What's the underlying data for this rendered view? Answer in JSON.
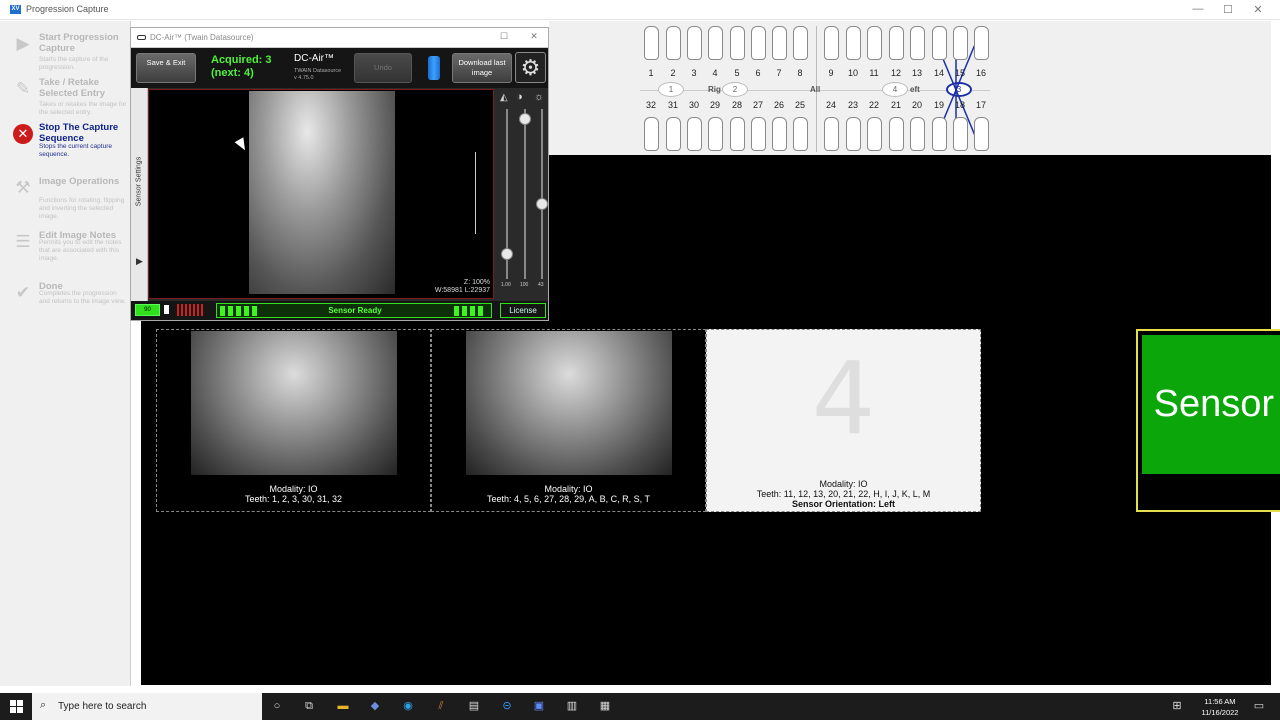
{
  "window": {
    "title": "Progression Capture",
    "app_icon": "XV"
  },
  "steps": [
    {
      "title": "Start Progression Capture",
      "desc": "Starts the capture of the progression.",
      "icon": "play-icon",
      "state": "disabled"
    },
    {
      "title": "Take / Retake Selected Entry",
      "desc": "Takes or retakes the image for the selected entry.",
      "icon": "retake-icon",
      "state": "disabled"
    },
    {
      "title": "Stop The Capture Sequence",
      "desc": "Stops the current capture sequence.",
      "icon": "stop-icon",
      "state": "active"
    },
    {
      "title": "Image Operations",
      "desc": "Functions for rotating, flipping and inverting the selected image.",
      "icon": "wrench-icon",
      "state": "disabled"
    },
    {
      "title": "Edit Image Notes",
      "desc": "Permits you to edit the notes that are associated with this image.",
      "icon": "notes-icon",
      "state": "disabled"
    },
    {
      "title": "Done",
      "desc": "Completes the progression and returns to the image view.",
      "icon": "check-icon",
      "state": "disabled"
    }
  ],
  "dc_air": {
    "title": "DC-Air™ (Twain Datasource)",
    "save_exit": "Save & Exit",
    "acquired_line1": "Acquired: 3",
    "acquired_line2": "(next: 4)",
    "product": "DC-Air™",
    "datasource": "TWAIN Datasource",
    "version": "v 4.75.0",
    "undo": "Undo",
    "download_last": "Download last image",
    "sensor_settings": "Sensor Settings",
    "zoom": "Z: 100%",
    "window_level": "W:58981 L:22937",
    "slider_values": [
      "1.00",
      "100",
      "43"
    ],
    "battery": "90",
    "status": "Sensor Ready",
    "license": "License"
  },
  "tooth_chart": {
    "upper": [
      "1",
      "2",
      "3",
      "4",
      "5",
      "6",
      "7",
      "8",
      "9",
      "10",
      "11",
      "12",
      "13",
      "14",
      "15",
      "16"
    ],
    "lower": [
      "32",
      "31",
      "30",
      "29",
      "28",
      "27",
      "26",
      "25",
      "24",
      "23",
      "22",
      "21",
      "20",
      "19",
      "18",
      "17"
    ],
    "quadrants": [
      "1",
      "2",
      "4",
      "3"
    ],
    "labels": {
      "right": "Rig",
      "all": "All",
      "left": "eft"
    },
    "selected_quadrant": "3"
  },
  "slots": [
    {
      "modality": "Modality: IO",
      "teeth": "Teeth: 1, 2, 3, 30, 31, 32"
    },
    {
      "modality": "Modality: IO",
      "teeth": "Teeth: 4, 5, 6, 27, 28, 29, A, B, C, R, S, T"
    },
    {
      "number": "4",
      "modality": "Modality: IO",
      "teeth": "Teeth: 11, 12, 13, 20, 21, 22, H, I, J, K, L, M",
      "orientation": "Sensor Orientation: Left"
    }
  ],
  "sensor_ready_big": "Sensor Ready",
  "taskbar": {
    "search_placeholder": "Type here to search",
    "time": "11:56 AM",
    "date": "11/16/2022"
  },
  "colors": {
    "accent_green": "#0aa60a",
    "status_green": "#31e11b",
    "stop_red": "#cc1b1b",
    "selection_blue": "#1a2ea8",
    "highlight_yellow": "#e3e04c"
  }
}
